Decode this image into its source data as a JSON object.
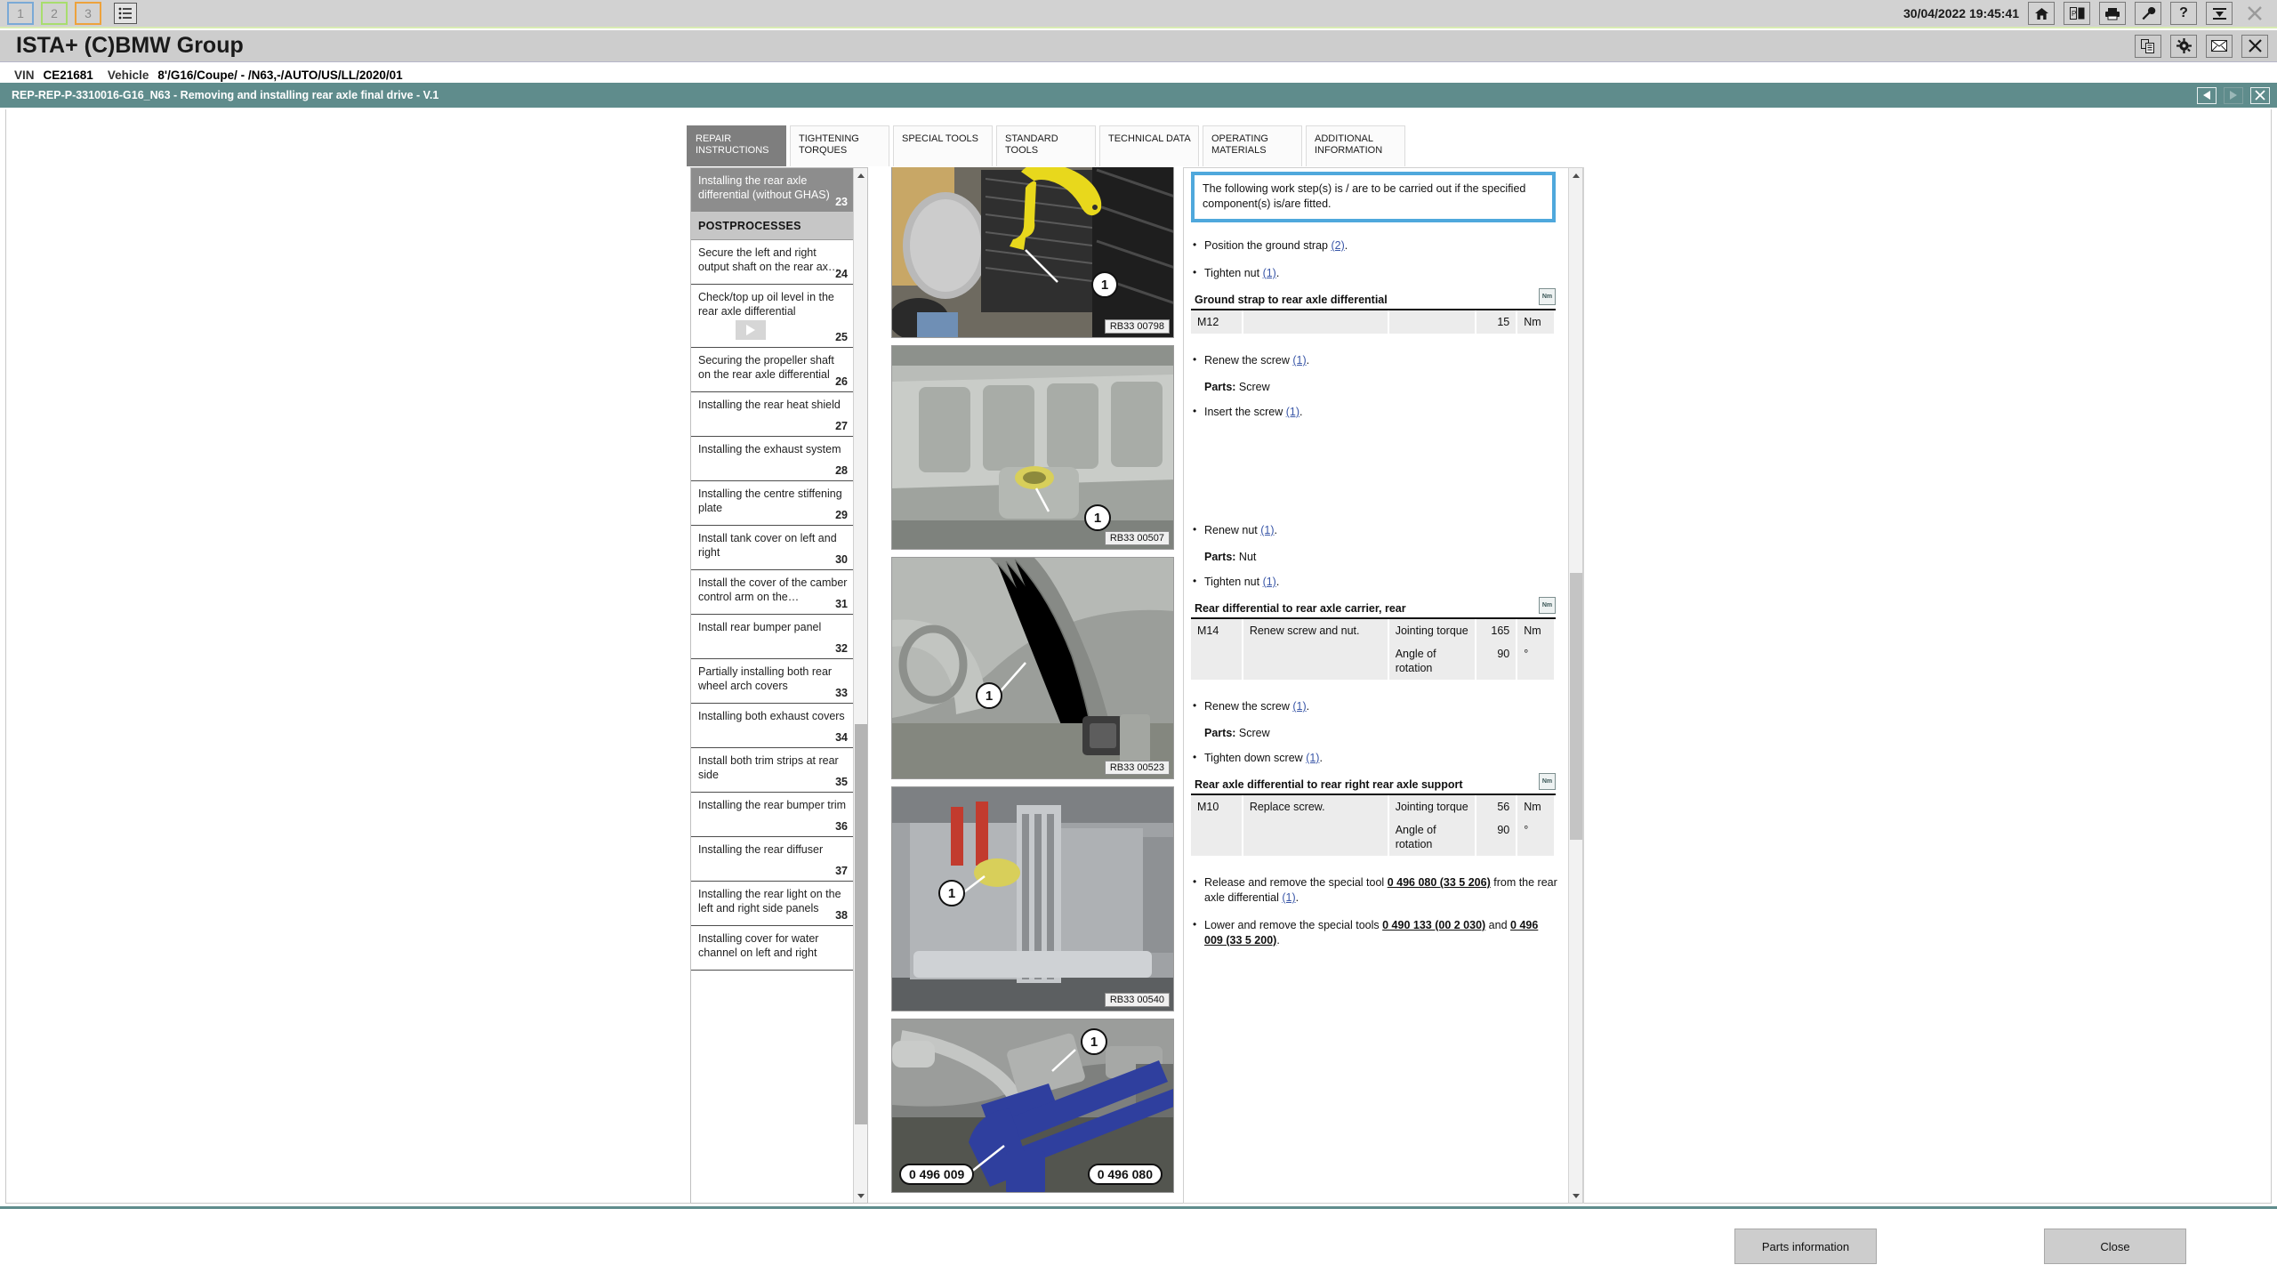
{
  "topbar": {
    "sessions": [
      {
        "label": "1",
        "accent": "#7aa9d6"
      },
      {
        "label": "2",
        "accent": "#a8dd6e"
      },
      {
        "label": "3",
        "accent": "#eda23c"
      }
    ],
    "list_icon": "list-icon",
    "timestamp": "30/04/2022 19:45:41",
    "buttons": [
      {
        "name": "home-icon",
        "glyph": "⌂"
      },
      {
        "name": "vehicle-id-icon",
        "glyph": "▣"
      },
      {
        "name": "print-icon",
        "glyph": "⎙"
      },
      {
        "name": "wrench-icon",
        "glyph": "⚒"
      },
      {
        "name": "help-icon",
        "glyph": "?"
      },
      {
        "name": "minimize-panel-icon",
        "glyph": "⤓"
      },
      {
        "name": "close-icon",
        "glyph": "✕"
      }
    ]
  },
  "title": {
    "app_title": "ISTA+ (C)BMW Group",
    "buttons": [
      {
        "name": "copy-document-icon",
        "glyph": "⧉"
      },
      {
        "name": "gear-icon",
        "glyph": "⚙"
      },
      {
        "name": "mail-icon",
        "glyph": "✉"
      },
      {
        "name": "close-window-icon",
        "glyph": "✕"
      }
    ]
  },
  "vin_bar": {
    "vin_label": "VIN",
    "vin_value": "CE21681",
    "vehicle_label": "Vehicle",
    "vehicle_value": "8'/G16/Coupe/ - /N63,-/AUTO/US/LL/2020/01"
  },
  "procedure_bar": {
    "title": "REP-REP-P-3310016-G16_N63 - Removing and installing rear axle final drive - V.1",
    "nav": [
      {
        "name": "previous-page-button",
        "enabled": true
      },
      {
        "name": "next-page-button",
        "enabled": false
      },
      {
        "name": "close-procedure-button",
        "enabled": true
      }
    ],
    "accent_color": "#5f8c8c"
  },
  "tabs": [
    {
      "label": "REPAIR INSTRUCTIONS",
      "active": true
    },
    {
      "label": "TIGHTENING TORQUES",
      "active": false
    },
    {
      "label": "SPECIAL TOOLS",
      "active": false
    },
    {
      "label": "STANDARD TOOLS",
      "active": false
    },
    {
      "label": "TECHNICAL DATA",
      "active": false
    },
    {
      "label": "OPERATING MATERIALS",
      "active": false
    },
    {
      "label": "ADDITIONAL INFORMATION",
      "active": false
    }
  ],
  "toc": [
    {
      "type": "item",
      "label": "Installing the rear axle differential (without GHAS)",
      "num": "23",
      "selected": true
    },
    {
      "type": "group",
      "label": "POSTPROCESSES"
    },
    {
      "type": "item",
      "label": "Secure the left and right output shaft on the rear ax…",
      "num": "24",
      "selected": false
    },
    {
      "type": "item",
      "label": "Check/top up oil level in the rear axle differential",
      "num": "25",
      "selected": false,
      "video": true
    },
    {
      "type": "item",
      "label": "Securing the propeller shaft on the rear axle differential",
      "num": "26",
      "selected": false
    },
    {
      "type": "item",
      "label": "Installing the rear heat shield",
      "num": "27",
      "selected": false
    },
    {
      "type": "item",
      "label": "Installing the exhaust system",
      "num": "28",
      "selected": false
    },
    {
      "type": "item",
      "label": "Installing the centre stiffening plate",
      "num": "29",
      "selected": false
    },
    {
      "type": "item",
      "label": "Install tank cover on left and right",
      "num": "30",
      "selected": false
    },
    {
      "type": "item",
      "label": "Install the cover of the camber control arm on the…",
      "num": "31",
      "selected": false
    },
    {
      "type": "item",
      "label": "Install rear bumper panel",
      "num": "32",
      "selected": false
    },
    {
      "type": "item",
      "label": "Partially installing both rear wheel arch covers",
      "num": "33",
      "selected": false
    },
    {
      "type": "item",
      "label": "Installing both exhaust covers",
      "num": "34",
      "selected": false
    },
    {
      "type": "item",
      "label": "Install both trim strips at rear side",
      "num": "35",
      "selected": false
    },
    {
      "type": "item",
      "label": "Installing the rear bumper trim",
      "num": "36",
      "selected": false
    },
    {
      "type": "item",
      "label": "Installing the rear diffuser",
      "num": "37",
      "selected": false
    },
    {
      "type": "item",
      "label": "Installing the rear light on the left and right side panels",
      "num": "38",
      "selected": false
    },
    {
      "type": "item",
      "label": "Installing cover for water channel on left and right",
      "num": "",
      "selected": false
    }
  ],
  "figures": [
    {
      "code": "RB33 00798",
      "callouts": [
        "1"
      ],
      "tools": []
    },
    {
      "code": "RB33 00507",
      "callouts": [
        "1"
      ],
      "tools": []
    },
    {
      "code": "RB33 00523",
      "callouts": [
        "1"
      ],
      "tools": []
    },
    {
      "code": "RB33 00540",
      "callouts": [
        "1"
      ],
      "tools": []
    },
    {
      "code": "",
      "callouts": [
        "1"
      ],
      "tools": [
        "0 496 009",
        "0 496 080"
      ]
    }
  ],
  "instructions": {
    "note": "The following work step(s) is / are to be carried out if the specified component(s) is/are fitted.",
    "blocks": [
      {
        "bullets": [
          {
            "pre": "Position the ground strap ",
            "link": "(2)",
            "post": "."
          },
          {
            "pre": "Tighten nut ",
            "link": "(1)",
            "post": "."
          }
        ],
        "torque": {
          "title": "Ground strap to rear axle differential",
          "icon": "nm-icon",
          "rows": [
            {
              "thread": "M12",
              "note": "",
              "kind": "",
              "value": "15",
              "unit": "Nm"
            }
          ]
        }
      },
      {
        "bullets": [
          {
            "pre": "Renew the screw ",
            "link": "(1)",
            "post": "."
          }
        ],
        "parts_label": "Parts:",
        "parts_value": "Screw",
        "bullets2": [
          {
            "pre": "Insert the screw ",
            "link": "(1)",
            "post": "."
          }
        ]
      },
      {
        "bullets": [
          {
            "pre": "Renew nut ",
            "link": "(1)",
            "post": "."
          }
        ],
        "parts_label": "Parts:",
        "parts_value": "Nut",
        "bullets2": [
          {
            "pre": "Tighten nut ",
            "link": "(1)",
            "post": "."
          }
        ],
        "torque": {
          "title": "Rear differential to rear axle carrier, rear",
          "icon": "nm-icon",
          "rows": [
            {
              "thread": "M14",
              "note": "Renew screw and nut.",
              "kind": "Jointing torque",
              "value": "165",
              "unit": "Nm"
            },
            {
              "thread": "",
              "note": "",
              "kind": "Angle of rotation",
              "value": "90",
              "unit": "°"
            }
          ]
        }
      },
      {
        "bullets": [
          {
            "pre": "Renew the screw ",
            "link": "(1)",
            "post": "."
          }
        ],
        "parts_label": "Parts:",
        "parts_value": "Screw",
        "bullets2": [
          {
            "pre": "Tighten down screw ",
            "link": "(1)",
            "post": "."
          }
        ],
        "torque": {
          "title": "Rear axle differential to rear right rear axle support",
          "icon": "nm-icon",
          "rows": [
            {
              "thread": "M10",
              "note": "Replace screw.",
              "kind": "Jointing torque",
              "value": "56",
              "unit": "Nm"
            },
            {
              "thread": "",
              "note": "",
              "kind": "Angle of rotation",
              "value": "90",
              "unit": "°"
            }
          ]
        }
      }
    ],
    "final_bullets": [
      {
        "p1": "Release and remove the special tool ",
        "tool1": "0 496 080 (33 5 206)",
        "p2": " from the rear axle differential ",
        "link": "(1)",
        "p3": "."
      },
      {
        "p1": "Lower and remove the special tools ",
        "tool1": "0 490 133 (00 2 030)",
        "p2": " and ",
        "tool2": "0 496 009 (33 5 200)",
        "p3": "."
      }
    ]
  },
  "footer": {
    "parts_button": "Parts information",
    "close_button": "Close"
  }
}
